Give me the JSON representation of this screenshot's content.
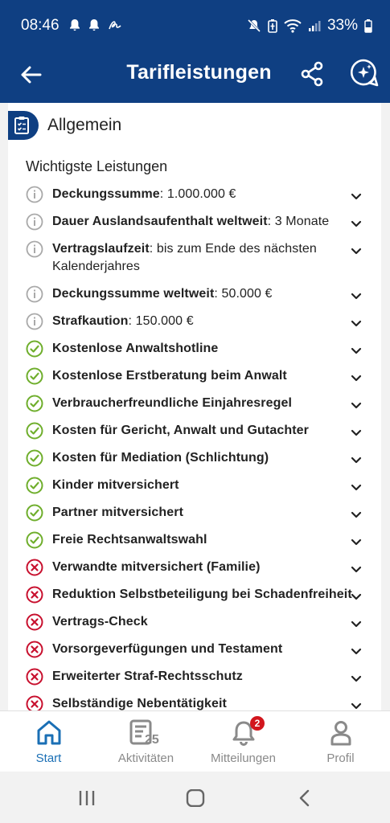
{
  "status_bar": {
    "time": "08:46",
    "battery": "33%"
  },
  "app_bar": {
    "title": "Tarifleistungen"
  },
  "section": {
    "title": "Allgemein",
    "subheading": "Wichtigste Leistungen"
  },
  "colors": {
    "primary": "#0f3f82",
    "included": "#6fae2c",
    "excluded": "#c8102e",
    "info": "#a9a9a9",
    "active_nav": "#1a6fb5"
  },
  "benefits": [
    {
      "status": "info",
      "label": "Deckungssumme",
      "value": ": 1.000.000 €"
    },
    {
      "status": "info",
      "label": "Dauer Auslandsaufenthalt weltweit",
      "value": ": 3 Monate"
    },
    {
      "status": "info",
      "label": "Vertragslaufzeit",
      "value": ": bis zum Ende des nächsten Kalenderjahres"
    },
    {
      "status": "info",
      "label": "Deckungssumme weltweit",
      "value": ": 50.000 €"
    },
    {
      "status": "info",
      "label": "Strafkaution",
      "value": ": 150.000 €"
    },
    {
      "status": "included",
      "label": "Kostenlose Anwaltshotline",
      "value": ""
    },
    {
      "status": "included",
      "label": "Kostenlose Erstberatung beim Anwalt",
      "value": ""
    },
    {
      "status": "included",
      "label": "Verbraucherfreundliche Einjahresregel",
      "value": ""
    },
    {
      "status": "included",
      "label": "Kosten für Gericht, Anwalt und Gutachter",
      "value": ""
    },
    {
      "status": "included",
      "label": "Kosten für Mediation (Schlichtung)",
      "value": ""
    },
    {
      "status": "included",
      "label": "Kinder mitversichert",
      "value": ""
    },
    {
      "status": "included",
      "label": "Partner mitversichert",
      "value": ""
    },
    {
      "status": "included",
      "label": "Freie Rechtsanwaltswahl",
      "value": ""
    },
    {
      "status": "excluded",
      "label": "Verwandte mitversichert (Familie)",
      "value": ""
    },
    {
      "status": "excluded",
      "label": "Reduktion Selbstbeteiligung bei Schadenfreiheit",
      "value": ""
    },
    {
      "status": "excluded",
      "label": "Vertrags-Check",
      "value": ""
    },
    {
      "status": "excluded",
      "label": "Vorsorgeverfügungen und Testament",
      "value": ""
    },
    {
      "status": "excluded",
      "label": "Erweiterter Straf-Rechtsschutz",
      "value": ""
    },
    {
      "status": "excluded",
      "label": "Selbständige Nebentätigkeit",
      "value": ""
    }
  ],
  "bottom_nav": {
    "start": "Start",
    "activities": "Aktivitäten",
    "activities_icon_number": "25",
    "notifications": "Mitteilungen",
    "notifications_badge": "2",
    "profile": "Profil"
  }
}
